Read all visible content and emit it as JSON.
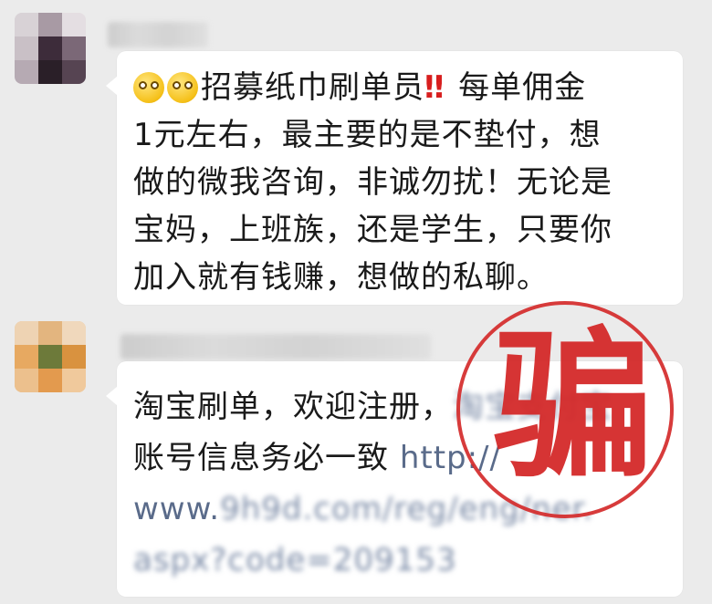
{
  "messages": [
    {
      "lines": [
        {
          "parts": [
            {
              "kind": "emoji",
              "name": "face-with-monocle-emoji"
            },
            {
              "kind": "emoji",
              "name": "face-with-monocle-emoji"
            },
            {
              "kind": "text",
              "text": "招募纸巾刷单员"
            },
            {
              "kind": "bang",
              "text": "‼"
            },
            {
              "kind": "text",
              "text": " 每单佣金"
            }
          ]
        },
        {
          "parts": [
            {
              "kind": "text",
              "text": "1元左右，最主要的是不垫付，想"
            }
          ]
        },
        {
          "parts": [
            {
              "kind": "text",
              "text": "做的微我咨询，非诚勿扰！无论是"
            }
          ]
        },
        {
          "parts": [
            {
              "kind": "text",
              "text": "宝妈，上班族，还是学生，只要你"
            }
          ]
        },
        {
          "parts": [
            {
              "kind": "text",
              "text": "加入就有钱赚，想做的私聊。"
            }
          ]
        }
      ]
    },
    {
      "lines": [
        {
          "parts": [
            {
              "kind": "text",
              "text": "淘宝刷单，欢迎注册，"
            },
            {
              "kind": "obscured",
              "text": "淘宝支付宝"
            }
          ]
        },
        {
          "parts": [
            {
              "kind": "text",
              "text": "账号信息务必一致 "
            },
            {
              "kind": "link",
              "text": "http://"
            }
          ]
        },
        {
          "parts": [
            {
              "kind": "link",
              "text": "www."
            },
            {
              "kind": "obscured",
              "text": "9h9d.com/reg/eng/ner."
            }
          ]
        },
        {
          "parts": [
            {
              "kind": "obscured",
              "text": "aspx?code=209153"
            }
          ]
        }
      ]
    }
  ],
  "stamp": {
    "text": "骗",
    "color": "#d42a2a"
  },
  "colors": {
    "background": "#ebebeb",
    "bubble": "#ffffff",
    "alert": "#d81e1e",
    "link": "#5a6b8a"
  }
}
